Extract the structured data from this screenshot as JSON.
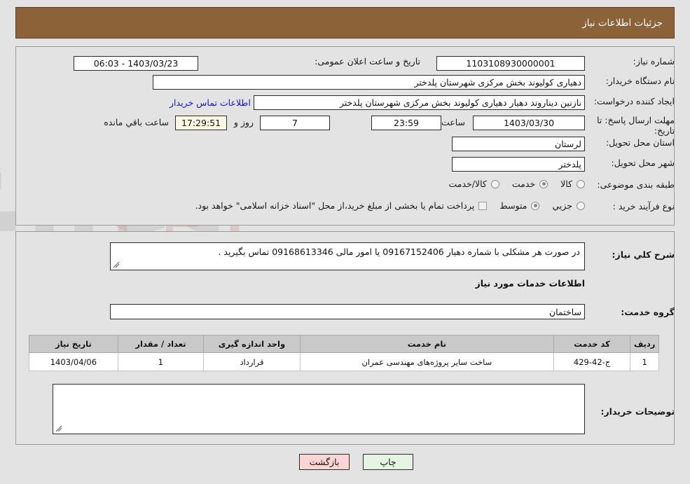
{
  "header": {
    "title": "جزئیات اطلاعات نیاز",
    "bg": "#8c6239"
  },
  "top": {
    "need_number_label": "شماره نیاز:",
    "need_number_value": "1103108930000001",
    "announce_label": "تاریخ و ساعت اعلان عمومی:",
    "announce_value": "1403/03/23 - 06:03",
    "buyer_org_label": "نام دستگاه خریدار:",
    "buyer_org_value": "دهیاری کولیوند بخش مرکزی شهرستان پلدختر",
    "creator_label": "ایجاد کننده درخواست:",
    "creator_value": "نازنین دیناروند دهیار دهیاری کولیوند بخش مرکزی شهرستان پلدختر",
    "contact_link": "اطلاعات تماس خریدار",
    "deadline_label": "مهلت ارسال پاسخ: تا تاریخ:",
    "deadline_date": "1403/03/30",
    "hour_label": "ساعت",
    "deadline_time": "23:59",
    "days_value": "7",
    "days_label": "روز و",
    "countdown": "17:29:51",
    "remaining_label": "ساعت باقي مانده",
    "province_label": "استان محل تحویل:",
    "province_value": "لرستان",
    "city_label": "شهر محل تحویل:",
    "city_value": "پلدختر",
    "classification_label": "طبقه بندی موضوعی:",
    "classification_options": [
      "کالا",
      "خدمت",
      "کالا/خدمت"
    ],
    "classification_selected": "خدمت",
    "process_label": "نوع فرآیند خرید :",
    "process_options": [
      "جزیي",
      "متوسط"
    ],
    "process_selected": "متوسط",
    "treasury_note": "پرداخت تمام یا بخشی از مبلغ خرید،از محل \"اسناد خزانه اسلامی\" خواهد بود.",
    "treasury_checked": false
  },
  "bottom": {
    "general_desc_label": "شرح کلي نیاز:",
    "general_desc_value": "در صورت هر مشکلی  با شماره دهیار 09167152406 یا امور مالی    09168613346 تماس بگیرید .",
    "services_heading": "اطلاعات خدمات مورد نیاز",
    "service_group_label": "گروه خدمت:",
    "service_group_value": "ساختمان",
    "buyer_notes_label": "توضیحات خریدار:",
    "buyer_notes_value": ""
  },
  "table": {
    "columns": [
      "ردیف",
      "کد خدمت",
      "نام خدمت",
      "واحد اندازه گیری",
      "تعداد / مقدار",
      "تاریخ نیاز"
    ],
    "rows": [
      {
        "index": "1",
        "code": "ج-42-429",
        "name": "ساخت سایر پروژه‌های مهندسی عمران",
        "unit": "قرارداد",
        "qty": "1",
        "date": "1403/04/06"
      }
    ]
  },
  "footer": {
    "print_label": "چاپ",
    "back_label": "بازگشت"
  },
  "watermark": {
    "text": "AriaTender.net"
  }
}
